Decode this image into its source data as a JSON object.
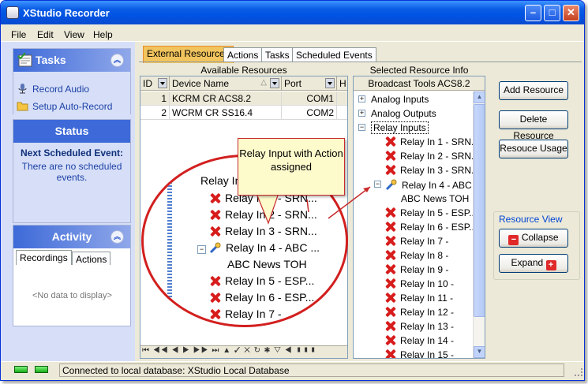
{
  "window": {
    "title": "XStudio Recorder"
  },
  "menu": {
    "items": [
      "File",
      "Edit",
      "View",
      "Help"
    ]
  },
  "tasks_panel": {
    "title": "Tasks",
    "items": [
      "Record Audio",
      "Setup Auto-Record"
    ]
  },
  "status_panel": {
    "title": "Status",
    "label": "Next Scheduled Event:",
    "text": "There are no scheduled events."
  },
  "activity_panel": {
    "title": "Activity",
    "tabs": [
      "Recordings",
      "Actions"
    ],
    "empty": "<No data to display>"
  },
  "main_tabs": [
    "External Resources",
    "Actions",
    "Tasks",
    "Scheduled Events"
  ],
  "available": {
    "title": "Available Resources",
    "columns": [
      "ID",
      "Device Name",
      "Port",
      "H"
    ],
    "rows": [
      {
        "id": "1",
        "device": "KCRM CR ACS8.2",
        "port": "COM1"
      },
      {
        "id": "2",
        "device": "WCRM CR SS16.4",
        "port": "COM2"
      }
    ]
  },
  "selected": {
    "title": "Selected Resource Info",
    "device": "Broadcast Tools ACS8.2",
    "groups": [
      "Analog Inputs",
      "Analog Outputs",
      "Relay Inputs"
    ],
    "relays": [
      "Relay In 1 - SRN...",
      "Relay In 2 - SRN...",
      "Relay In 3 - SRN...",
      "Relay In 4 - ABC ...",
      "Relay In 5 - ESP...",
      "Relay In 6 - ESP...",
      "Relay In 7 -",
      "Relay In 8 -",
      "Relay In 9 -",
      "Relay In 10 -",
      "Relay In 11 -",
      "Relay In 12 -",
      "Relay In 13 -",
      "Relay In 14 -",
      "Relay In 15 -"
    ],
    "action": "ABC News TOH"
  },
  "buttons": {
    "add": "Add Resource",
    "delete": "Delete Resource",
    "usage": "Resouce Usage",
    "view_title": "Resource View",
    "collapse": "Collapse",
    "expand": "Expand"
  },
  "callout": {
    "text": "Relay Input with Action assigned"
  },
  "magnified": {
    "partial": "Relay Inpu",
    "rows": [
      "Relay In 1 - SRN...",
      "Relay In 2 - SRN...",
      "Relay In 3 - SRN...",
      "Relay In 4 - ABC ...",
      "ABC News TOH",
      "Relay In 5 - ESP...",
      "Relay In 6 - ESP...",
      "Relay In 7 -"
    ]
  },
  "statusbar": {
    "text": "Connected to local database: XStudio Local Database"
  }
}
